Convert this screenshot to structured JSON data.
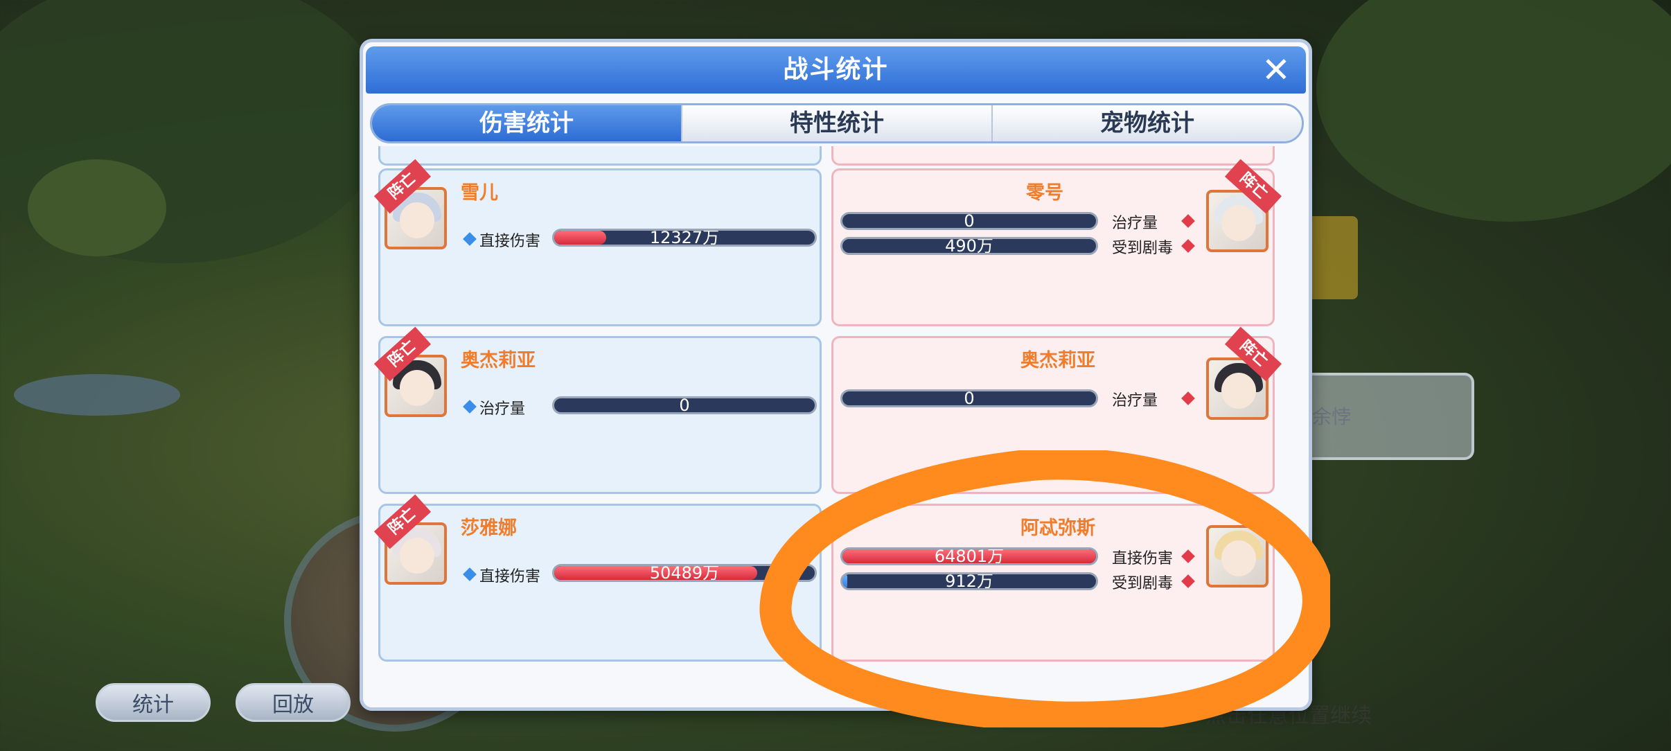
{
  "background": {
    "buttons": [
      "统计",
      "回放"
    ],
    "right_panel_text": "余悖",
    "hint_text": "点击任意位置继续"
  },
  "modal": {
    "title": "战斗统计",
    "tabs": [
      {
        "label": "伤害统计",
        "active": true
      },
      {
        "label": "特性统计",
        "active": false
      },
      {
        "label": "宠物统计",
        "active": false
      }
    ],
    "death_tag": "阵亡"
  },
  "rows": [
    {
      "left": {
        "name": "雪儿",
        "dead": true,
        "hair_color": "#c9d3e6",
        "stats": [
          {
            "label": "直接伤害",
            "value": "12327万",
            "fill": 0.2
          }
        ]
      },
      "right": {
        "name": "零号",
        "dead": true,
        "hair_color": "#e3e7ee",
        "stats": [
          {
            "label": "治疗量",
            "value": "0",
            "fill": 0
          },
          {
            "label": "受到剧毒",
            "value": "490万",
            "fill": 0
          }
        ]
      }
    },
    {
      "left": {
        "name": "奥杰莉亚",
        "dead": true,
        "hair_color": "#2f2f35",
        "stats": [
          {
            "label": "治疗量",
            "value": "0",
            "fill": 0
          }
        ]
      },
      "right": {
        "name": "奥杰莉亚",
        "dead": true,
        "hair_color": "#2f2f35",
        "stats": [
          {
            "label": "治疗量",
            "value": "0",
            "fill": 0
          }
        ]
      }
    },
    {
      "left": {
        "name": "莎雅娜",
        "dead": true,
        "hair_color": "#e8e2e6",
        "stats": [
          {
            "label": "直接伤害",
            "value": "50489万",
            "fill": 0.78
          }
        ]
      },
      "right": {
        "name": "阿忒弥斯",
        "dead": false,
        "hair_color": "#f0d9a2",
        "stats": [
          {
            "label": "直接伤害",
            "value": "64801万",
            "fill": 1.0
          },
          {
            "label": "受到剧毒",
            "value": "912万",
            "fill": 0.02
          }
        ]
      }
    }
  ],
  "colors": {
    "accent_blue": "#2f6ed6",
    "damage_red": "#d52b3c",
    "name_orange": "#ef7d2b",
    "annotation_orange": "#ff8a1d"
  }
}
